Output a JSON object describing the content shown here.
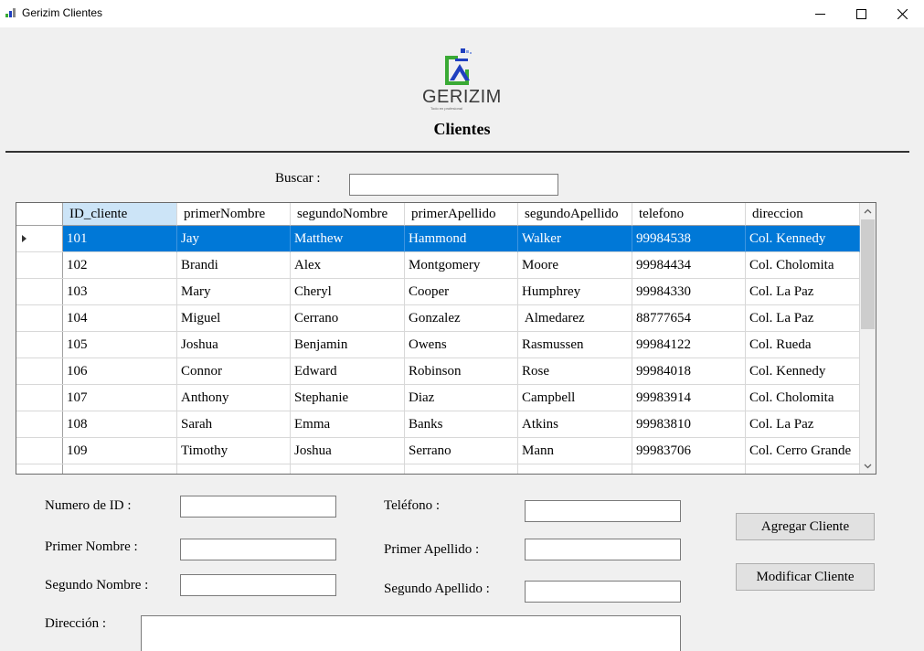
{
  "window": {
    "title": "Gerizim Clientes",
    "controls": [
      "minimize",
      "maximize",
      "close"
    ]
  },
  "header": {
    "logo_text": "GERIZIM",
    "logo_tagline": "Todo en profesional",
    "title": "Clientes"
  },
  "search": {
    "label": "Buscar :",
    "value": ""
  },
  "grid": {
    "columns": [
      "ID_cliente",
      "primerNombre",
      "segundoNombre",
      "primerApellido",
      "segundoApellido",
      "telefono",
      "direccion"
    ],
    "selected_row": 0,
    "rows": [
      [
        "101",
        "Jay",
        "Matthew",
        "Hammond",
        "Walker",
        "99984538",
        "Col. Kennedy"
      ],
      [
        "102",
        "Brandi",
        "Alex",
        "Montgomery",
        "Moore",
        "99984434",
        "Col. Cholomita"
      ],
      [
        "103",
        "Mary",
        "Cheryl",
        "Cooper",
        "Humphrey",
        "99984330",
        "Col. La Paz"
      ],
      [
        "104",
        "Miguel",
        "Cerrano",
        "Gonzalez",
        " Almedarez",
        "88777654",
        "Col. La Paz"
      ],
      [
        "105",
        "Joshua",
        "Benjamin",
        "Owens",
        "Rasmussen",
        "99984122",
        "Col. Rueda"
      ],
      [
        "106",
        "Connor",
        "Edward",
        "Robinson",
        "Rose",
        "99984018",
        "Col. Kennedy"
      ],
      [
        "107",
        "Anthony",
        "Stephanie",
        "Diaz",
        "Campbell",
        "99983914",
        "Col. Cholomita"
      ],
      [
        "108",
        "Sarah",
        "Emma",
        "Banks",
        "Atkins",
        "99983810",
        "Col. La Paz"
      ],
      [
        "109",
        "Timothy",
        "Joshua",
        "Serrano",
        "Mann",
        "99983706",
        "Col. Cerro Grande"
      ]
    ]
  },
  "form": {
    "numero_id_label": "Numero de ID :",
    "primer_nombre_label": "Primer Nombre :",
    "segundo_nombre_label": "Segundo Nombre :",
    "direccion_label": "Dirección :",
    "telefono_label": "Teléfono :",
    "primer_apellido_label": "Primer Apellido :",
    "segundo_apellido_label": "Segundo Apellido :"
  },
  "actions": {
    "add_label": "Agregar Cliente",
    "modify_label": "Modificar Cliente"
  },
  "colors": {
    "selection": "#0078d7",
    "sorted_header": "#cce4f7",
    "logo_green": "#3aaa35",
    "logo_blue": "#1f3fbf"
  }
}
